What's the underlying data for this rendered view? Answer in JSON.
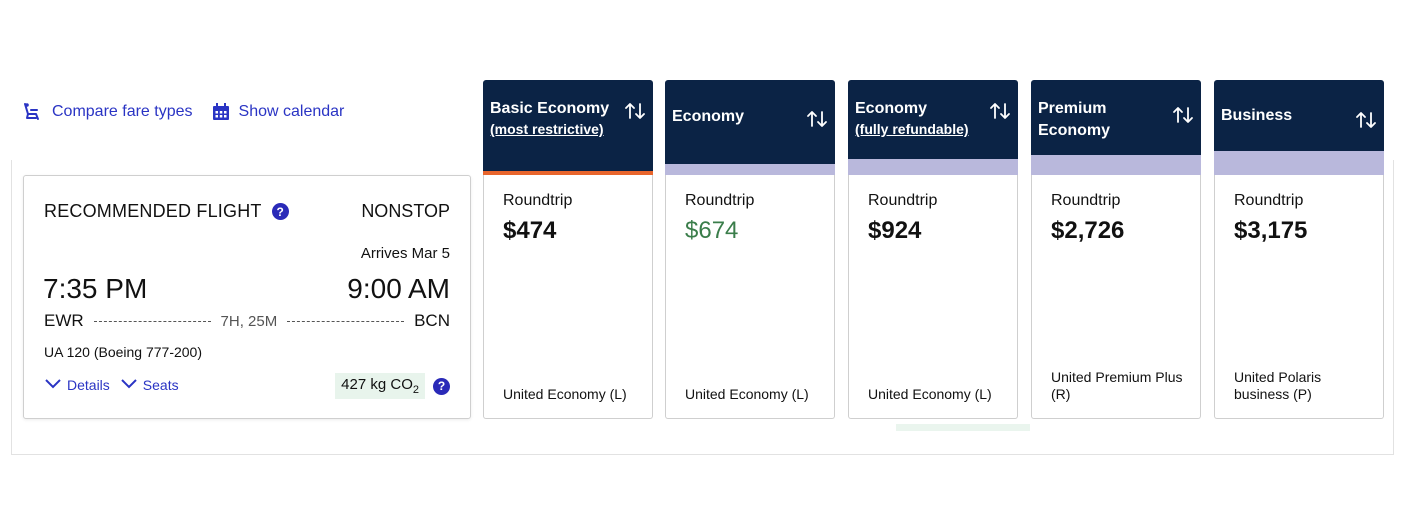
{
  "toolbar": {
    "compare_label": "Compare fare types",
    "calendar_label": "Show calendar"
  },
  "recommended": {
    "title": "RECOMMENDED FLIGHT",
    "help": "?",
    "stops": "NONSTOP",
    "arrives": "Arrives Mar 5",
    "depart_time": "7:35 PM",
    "arrive_time": "9:00 AM",
    "origin": "EWR",
    "destination": "BCN",
    "duration": "7H, 25M",
    "flight": "UA 120 (Boeing 777-200)",
    "details_label": "Details",
    "seats_label": "Seats",
    "co2_value": "427 kg CO",
    "co2_sub": "2",
    "co2_help": "?"
  },
  "fares": [
    {
      "name": "Basic Economy",
      "sub": "(most restrictive)",
      "label": "Roundtrip",
      "price": "$474",
      "class": "United Economy (L)",
      "band": "orange"
    },
    {
      "name": "Economy",
      "sub": "",
      "label": "Roundtrip",
      "price": "$674",
      "class": "United Economy (L)",
      "band": "lavender",
      "price_color": "#3a7d4a"
    },
    {
      "name": "Economy",
      "sub": "(fully refundable)",
      "label": "Roundtrip",
      "price": "$924",
      "class": "United Economy (L)",
      "band": "lavender"
    },
    {
      "name": "Premium Economy",
      "sub": "",
      "label": "Roundtrip",
      "price": "$2,726",
      "class": "United Premium Plus (R)",
      "band": "lavender"
    },
    {
      "name": "Business",
      "sub": "",
      "label": "Roundtrip",
      "price": "$3,175",
      "class": "United Polaris business (P)",
      "band": "lavender"
    }
  ],
  "colors": {
    "header_navy": "#0b2345",
    "link_blue": "#2a34c4",
    "band_lavender": "#b9b8dc",
    "band_orange": "#e8652c",
    "price_green": "#3a7d4a"
  }
}
